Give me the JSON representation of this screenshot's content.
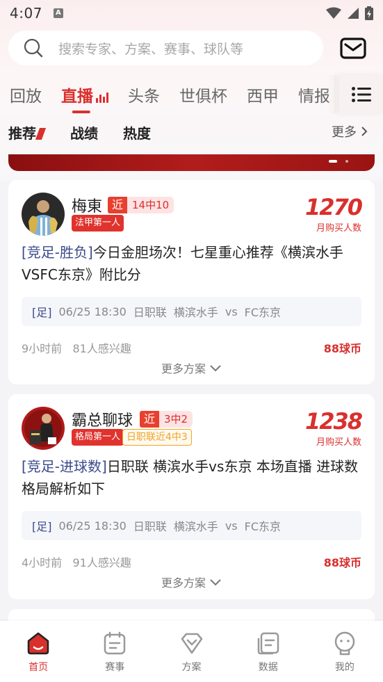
{
  "status_bar": {
    "time": "4:07",
    "notif_icon": "a-icon"
  },
  "search": {
    "placeholder": "搜索专家、方案、赛事、球队等"
  },
  "channel_tabs": [
    {
      "label": "回放",
      "active": false
    },
    {
      "label": "直播",
      "active": true
    },
    {
      "label": "头条",
      "active": false
    },
    {
      "label": "世俱杯",
      "active": false
    },
    {
      "label": "西甲",
      "active": false
    },
    {
      "label": "情报",
      "active": false
    }
  ],
  "sub_tabs": [
    "推荐",
    "战绩",
    "热度"
  ],
  "more_label": "更多",
  "colors": {
    "accent": "#d9302d",
    "category": "#3a4a8c"
  },
  "cards": [
    {
      "expert": "梅東",
      "recent_tag": "近",
      "recent_stat": "14中10",
      "title_tags": [
        "法甲第一人"
      ],
      "buyers": "1270",
      "buyers_label": "月购买人数",
      "category": "[竞足-胜负]",
      "title": "今日金胆场次！七星重心推荐《横滨水手VSFC东京》附比分",
      "match": {
        "sport": "[足]",
        "time": "06/25 18:30",
        "league": "日职联",
        "home": "横滨水手",
        "vs": "vs",
        "away": "FC东京"
      },
      "posted": "9小时前",
      "interest": "81人感兴趣",
      "price": "88球币",
      "more_plans": "更多方案"
    },
    {
      "expert": "霸总聊球",
      "recent_tag": "近",
      "recent_stat": "3中2",
      "title_tags": [
        "格局第一人",
        "日职联近4中3"
      ],
      "buyers": "1238",
      "buyers_label": "月购买人数",
      "category": "[竞足-进球数]",
      "title": "日职联  横滨水手vs东京   本场直播   进球数 格局解析如下",
      "match": {
        "sport": "[足]",
        "time": "06/25 18:30",
        "league": "日职联",
        "home": "横滨水手",
        "vs": "vs",
        "away": "FC东京"
      },
      "posted": "4小时前",
      "interest": "91人感兴趣",
      "price": "88球币",
      "more_plans": "更多方案"
    }
  ],
  "bottom_nav": [
    {
      "label": "首页",
      "icon": "home-icon",
      "active": true
    },
    {
      "label": "赛事",
      "icon": "calendar-icon",
      "active": false
    },
    {
      "label": "方案",
      "icon": "diamond-icon",
      "active": false
    },
    {
      "label": "数据",
      "icon": "data-icon",
      "active": false
    },
    {
      "label": "我的",
      "icon": "profile-icon",
      "active": false
    }
  ]
}
